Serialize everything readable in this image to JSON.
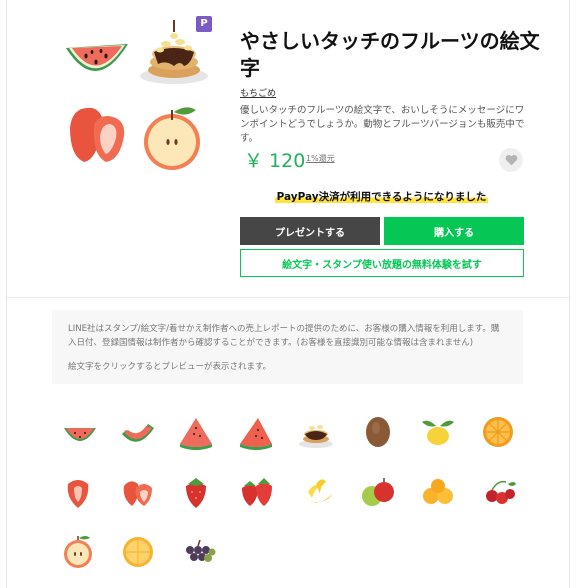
{
  "product": {
    "title": "やさしいタッチのフルーツの絵文字",
    "author": "もちごめ",
    "description": "優しいタッチのフルーツの絵文字で、おいしそうにメッセージにワンポイントどうでしょうか。動物とフルーツバージョンも販売中です。",
    "price": "￥ 120",
    "price_note": "1%還元",
    "premium_badge": "P"
  },
  "paypay_notice": "PayPay決済が利用できるようになりました",
  "buttons": {
    "gift": "プレゼントする",
    "buy": "購入する",
    "trial": "絵文字・スタンプ使い放題の無料体験を試す"
  },
  "notice": {
    "line1": "LINE社はスタンプ/絵文字/着せかえ制作者への売上レポートの提供のために、お客様の購入情報を利用します。購入日付、登録国情報は制作者から確認することができます。(お客様を直接識別可能な情報は含まれません)",
    "line2": "絵文字をクリックするとプレビューが表示されます。"
  },
  "colors": {
    "accent_green": "#06c755",
    "price_green": "#1fb25a",
    "gift_dark": "#464646",
    "premium_purple": "#7b5cc4",
    "paypay_highlight": "#ffe53b"
  },
  "hero_icons": [
    "watermelon-icon",
    "pancake-icon",
    "strawberry-icon",
    "apple-slice-icon"
  ],
  "emoji": [
    "watermelon-slice-icon",
    "watermelon-bite-icon",
    "watermelon-wedge-icon",
    "watermelon-wedge-2-icon",
    "pancake-icon",
    "kiwi-icon",
    "lemon-icon",
    "orange-slice-icon",
    "strawberry-half-icon",
    "strawberry-pair-icon",
    "strawberry-icon",
    "strawberry-double-icon",
    "banana-icon",
    "apples-icon",
    "oranges-icon",
    "cherries-icon",
    "apple-half-icon",
    "orange-round-icon",
    "grapes-icon"
  ]
}
